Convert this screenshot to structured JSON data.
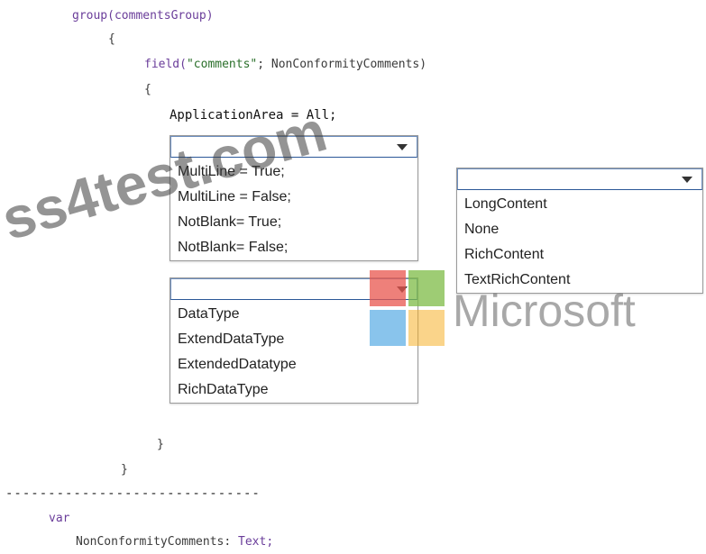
{
  "code": {
    "line1": "group(commentsGroup)",
    "brace_open1": "{",
    "line_field_kw": "field(",
    "line_field_str": "\"comments\"",
    "line_field_rest": "; NonConformityComments)",
    "brace_open2": "{",
    "line_app": "ApplicationArea = All;",
    "brace_close2": "}",
    "brace_close1": "}",
    "separator": "------------------------------",
    "var_kw": "var",
    "var_name": "NonConformityComments: ",
    "var_type": "Text;"
  },
  "dropdown1": {
    "options": [
      "MultiLine = True;",
      "MultiLine = False;",
      "NotBlank= True;",
      "NotBlank= False;"
    ]
  },
  "dropdown2": {
    "options": [
      "LongContent",
      "None",
      "RichContent",
      "TextRichContent"
    ]
  },
  "dropdown3": {
    "options": [
      "DataType",
      "ExtendDataType",
      "ExtendedDatatype",
      "RichDataType"
    ]
  },
  "watermark": {
    "text1": "ss4test.com",
    "text2": "Microsoft"
  },
  "colors": {
    "ms_red": "#e8554e",
    "ms_green": "#7dbb45",
    "ms_blue": "#3b9de0",
    "ms_yellow": "#f5b12a"
  }
}
